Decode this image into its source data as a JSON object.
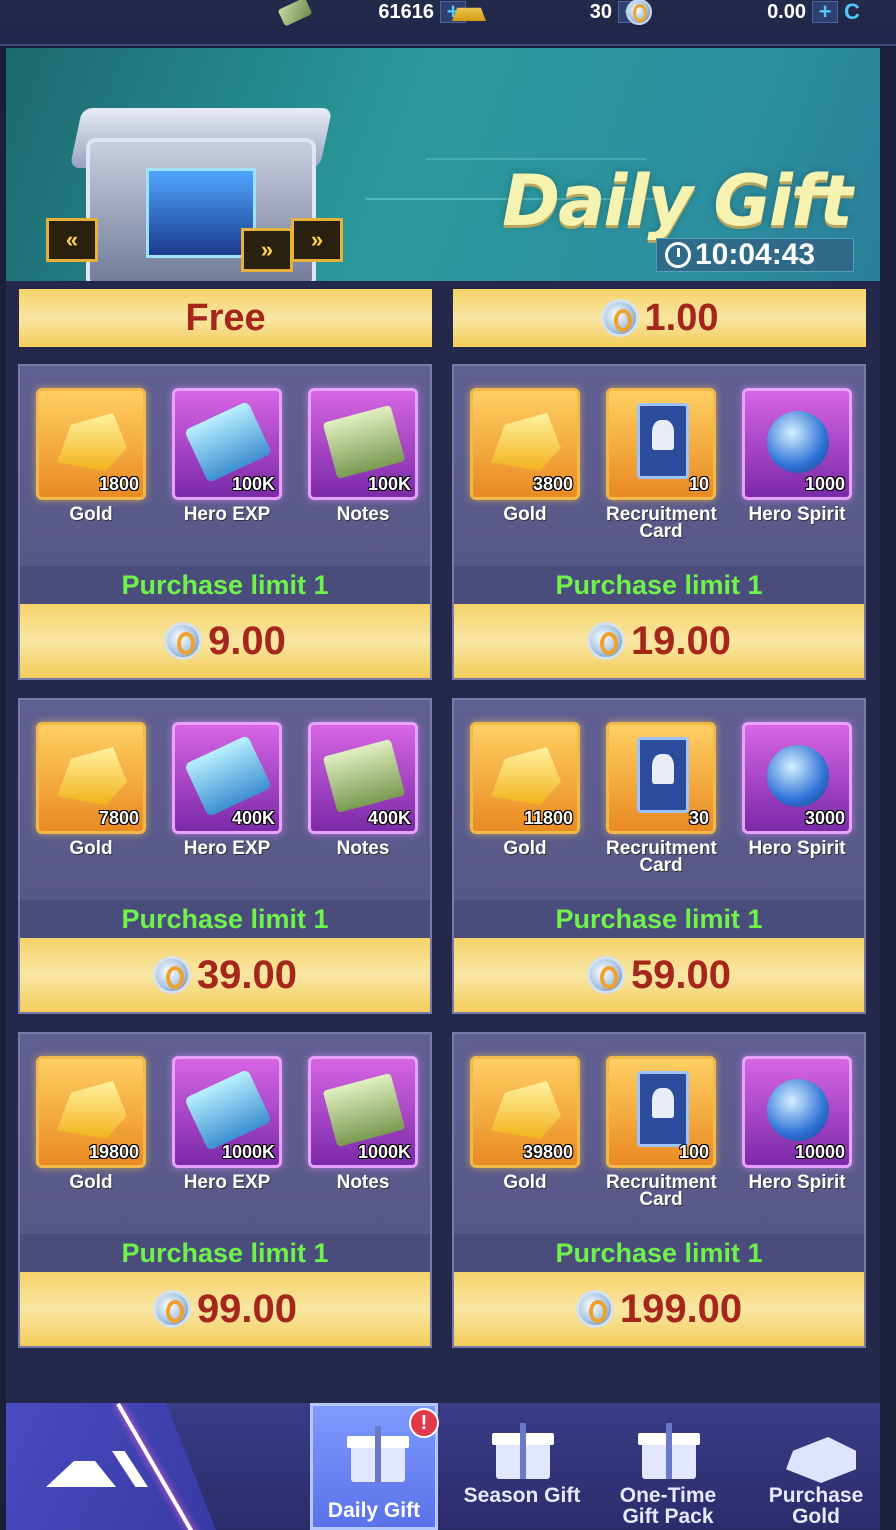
{
  "resources": [
    {
      "icon": "cash-icon",
      "value": "61616"
    },
    {
      "icon": "gold-bar-icon",
      "value": "30"
    },
    {
      "icon": "coin-icon",
      "value": "0.00"
    }
  ],
  "banner": {
    "title": "Daily Gift",
    "timer": "10:04:43"
  },
  "free_row": {
    "left_label": "Free",
    "right_price": "1.00"
  },
  "packs": [
    {
      "items": [
        {
          "name": "Gold",
          "qty": "1800",
          "icon": "gold-icon"
        },
        {
          "name": "Hero EXP",
          "qty": "100K",
          "icon": "hero-exp-icon"
        },
        {
          "name": "Notes",
          "qty": "100K",
          "icon": "notes-icon"
        }
      ],
      "limit": "Purchase limit 1",
      "price": "9.00"
    },
    {
      "items": [
        {
          "name": "Gold",
          "qty": "3800",
          "icon": "gold-icon"
        },
        {
          "name": "Recruitment Card",
          "qty": "10",
          "icon": "recruitment-card-icon"
        },
        {
          "name": "Hero Spirit",
          "qty": "1000",
          "icon": "hero-spirit-icon"
        }
      ],
      "limit": "Purchase limit 1",
      "price": "19.00"
    },
    {
      "items": [
        {
          "name": "Gold",
          "qty": "7800",
          "icon": "gold-icon"
        },
        {
          "name": "Hero EXP",
          "qty": "400K",
          "icon": "hero-exp-icon"
        },
        {
          "name": "Notes",
          "qty": "400K",
          "icon": "notes-icon"
        }
      ],
      "limit": "Purchase limit 1",
      "price": "39.00"
    },
    {
      "items": [
        {
          "name": "Gold",
          "qty": "11800",
          "icon": "gold-icon"
        },
        {
          "name": "Recruitment Card",
          "qty": "30",
          "icon": "recruitment-card-icon"
        },
        {
          "name": "Hero Spirit",
          "qty": "3000",
          "icon": "hero-spirit-icon"
        }
      ],
      "limit": "Purchase limit 1",
      "price": "59.00"
    },
    {
      "items": [
        {
          "name": "Gold",
          "qty": "19800",
          "icon": "gold-icon"
        },
        {
          "name": "Hero EXP",
          "qty": "1000K",
          "icon": "hero-exp-icon"
        },
        {
          "name": "Notes",
          "qty": "1000K",
          "icon": "notes-icon"
        }
      ],
      "limit": "Purchase limit 1",
      "price": "99.00"
    },
    {
      "items": [
        {
          "name": "Gold",
          "qty": "39800",
          "icon": "gold-icon"
        },
        {
          "name": "Recruitment Card",
          "qty": "100",
          "icon": "recruitment-card-icon"
        },
        {
          "name": "Hero Spirit",
          "qty": "10000",
          "icon": "hero-spirit-icon"
        }
      ],
      "limit": "Purchase limit 1",
      "price": "199.00"
    }
  ],
  "nav": {
    "tabs": [
      {
        "label": "Daily Gift",
        "active": true,
        "badge": "!"
      },
      {
        "label": "Season Gift"
      },
      {
        "label": "One-Time Gift Pack"
      },
      {
        "label": "Purchase Gold"
      }
    ]
  },
  "colors": {
    "price_text": "#a5261b",
    "limit_text": "#6ff24a",
    "banner_bg": "#2a9a9c"
  }
}
